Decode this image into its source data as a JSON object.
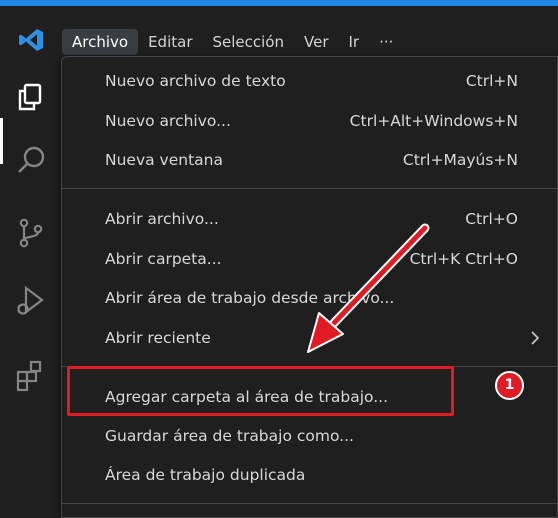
{
  "menubar": {
    "items": [
      {
        "label": "Archivo",
        "active": true
      },
      {
        "label": "Editar"
      },
      {
        "label": "Selección"
      },
      {
        "label": "Ver"
      },
      {
        "label": "Ir"
      },
      {
        "label": "···"
      }
    ]
  },
  "activitybar": {
    "icons": [
      "explorer-icon",
      "search-icon",
      "source-control-icon",
      "run-debug-icon",
      "extensions-icon"
    ]
  },
  "file_menu": {
    "items": [
      {
        "label": "Nuevo archivo de texto",
        "shortcut": "Ctrl+N"
      },
      {
        "label": "Nuevo archivo...",
        "shortcut": "Ctrl+Alt+Windows+N"
      },
      {
        "label": "Nueva ventana",
        "shortcut": "Ctrl+Mayús+N"
      },
      {
        "label": "Abrir archivo...",
        "shortcut": "Ctrl+O"
      },
      {
        "label": "Abrir carpeta...",
        "shortcut": "Ctrl+K Ctrl+O"
      },
      {
        "label": "Abrir área de trabajo desde archivo..."
      },
      {
        "label": "Abrir reciente"
      },
      {
        "label": "Agregar carpeta al área de trabajo..."
      },
      {
        "label": "Guardar área de trabajo como..."
      },
      {
        "label": "Área de trabajo duplicada"
      }
    ]
  },
  "annotation": {
    "step_number": "1",
    "color": "#e01b24"
  },
  "colors": {
    "background": "#1f1f1f",
    "menu_border": "#454545",
    "accent_blue": "#1e88e5",
    "active_menu": "#3a3d41"
  }
}
